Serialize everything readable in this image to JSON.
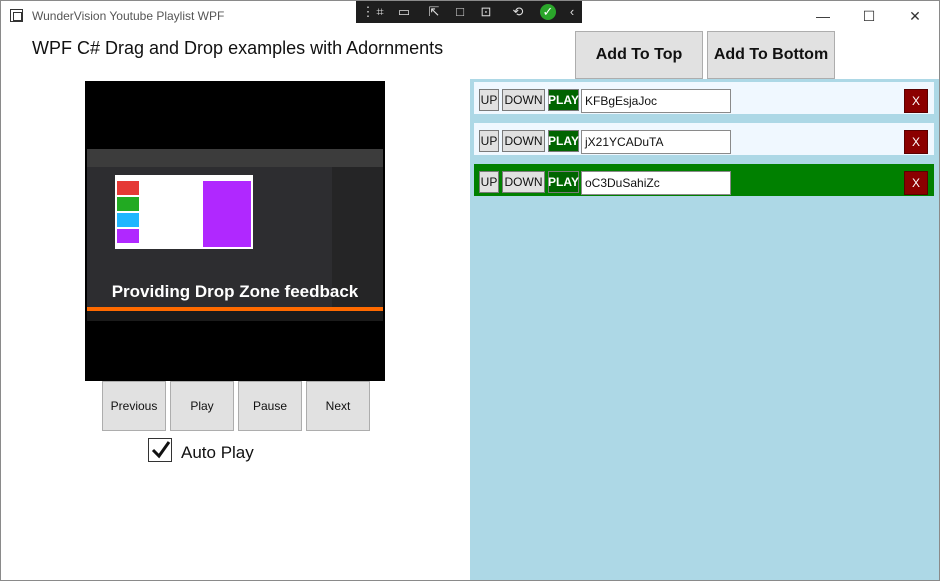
{
  "window": {
    "title": "WunderVision Youtube Playlist WPF",
    "minimize": "—",
    "maximize": "☐",
    "close": "✕"
  },
  "heading": "WPF C# Drag and Drop examples with Adornments",
  "video": {
    "caption": "Providing Drop Zone feedback"
  },
  "controls": {
    "previous": "Previous",
    "play": "Play",
    "pause": "Pause",
    "next": "Next"
  },
  "autoplay": {
    "label": "Auto Play",
    "checked": true
  },
  "actions": {
    "add_top": "Add To Top",
    "add_bottom": "Add To Bottom"
  },
  "playlist": [
    {
      "up": "UP",
      "down": "DOWN",
      "play": "PLAY",
      "id": "KFBgEsjaJoc",
      "remove": "X"
    },
    {
      "up": "UP",
      "down": "DOWN",
      "play": "PLAY",
      "id": "jX21YCADuTA",
      "remove": "X"
    },
    {
      "up": "UP",
      "down": "DOWN",
      "play": "PLAY",
      "id": "oC3DuSahiZc",
      "remove": "X"
    }
  ],
  "colors": {
    "panel": "#add8e6",
    "row": "#f0f8ff",
    "active_row": "#008000",
    "play": "#006400",
    "remove": "#8b0000"
  }
}
